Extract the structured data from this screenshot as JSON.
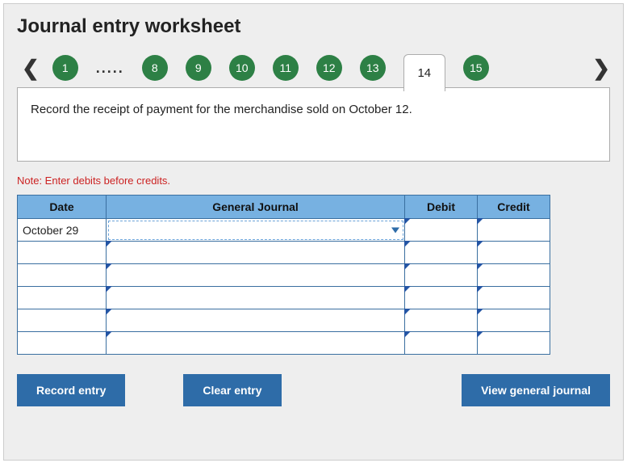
{
  "title": "Journal entry worksheet",
  "steps": {
    "items": [
      "1",
      "8",
      "9",
      "10",
      "11",
      "12",
      "13"
    ],
    "active": "14",
    "after": [
      "15"
    ]
  },
  "prompt": "Record the receipt of payment for the merchandise sold on October 12.",
  "note": "Note: Enter debits before credits.",
  "table": {
    "headers": {
      "date": "Date",
      "gj": "General Journal",
      "debit": "Debit",
      "credit": "Credit"
    },
    "rows": [
      {
        "date": "October 29",
        "gj": "",
        "debit": "",
        "credit": "",
        "active": true
      },
      {
        "date": "",
        "gj": "",
        "debit": "",
        "credit": ""
      },
      {
        "date": "",
        "gj": "",
        "debit": "",
        "credit": ""
      },
      {
        "date": "",
        "gj": "",
        "debit": "",
        "credit": ""
      },
      {
        "date": "",
        "gj": "",
        "debit": "",
        "credit": ""
      },
      {
        "date": "",
        "gj": "",
        "debit": "",
        "credit": ""
      }
    ]
  },
  "buttons": {
    "record": "Record entry",
    "clear": "Clear entry",
    "view": "View general journal"
  }
}
